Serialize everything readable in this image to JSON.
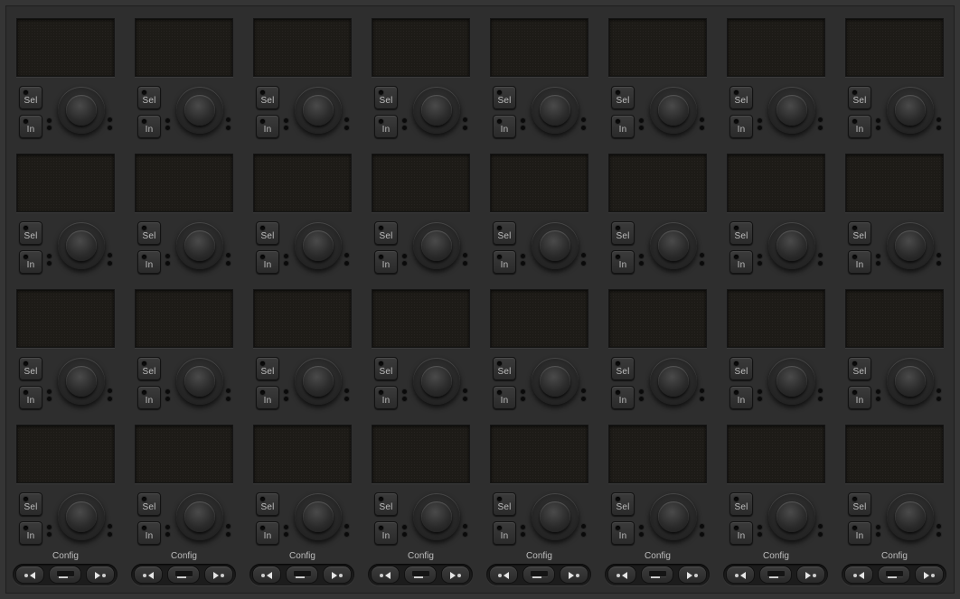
{
  "controls": {
    "sel_label": "Sel",
    "in_label": "In",
    "config_label": "Config"
  },
  "layout_info": {
    "strips": 8,
    "rows_per_strip": 4
  },
  "icons": {
    "prev": "triangle-left-icon",
    "next": "triangle-right-icon",
    "mode": "fader-mode-icon",
    "led": "led-indicator-icon"
  },
  "colors": {
    "panel": "#2e2e2e",
    "display": "#1d1b17",
    "label": "#bdbdbd"
  }
}
